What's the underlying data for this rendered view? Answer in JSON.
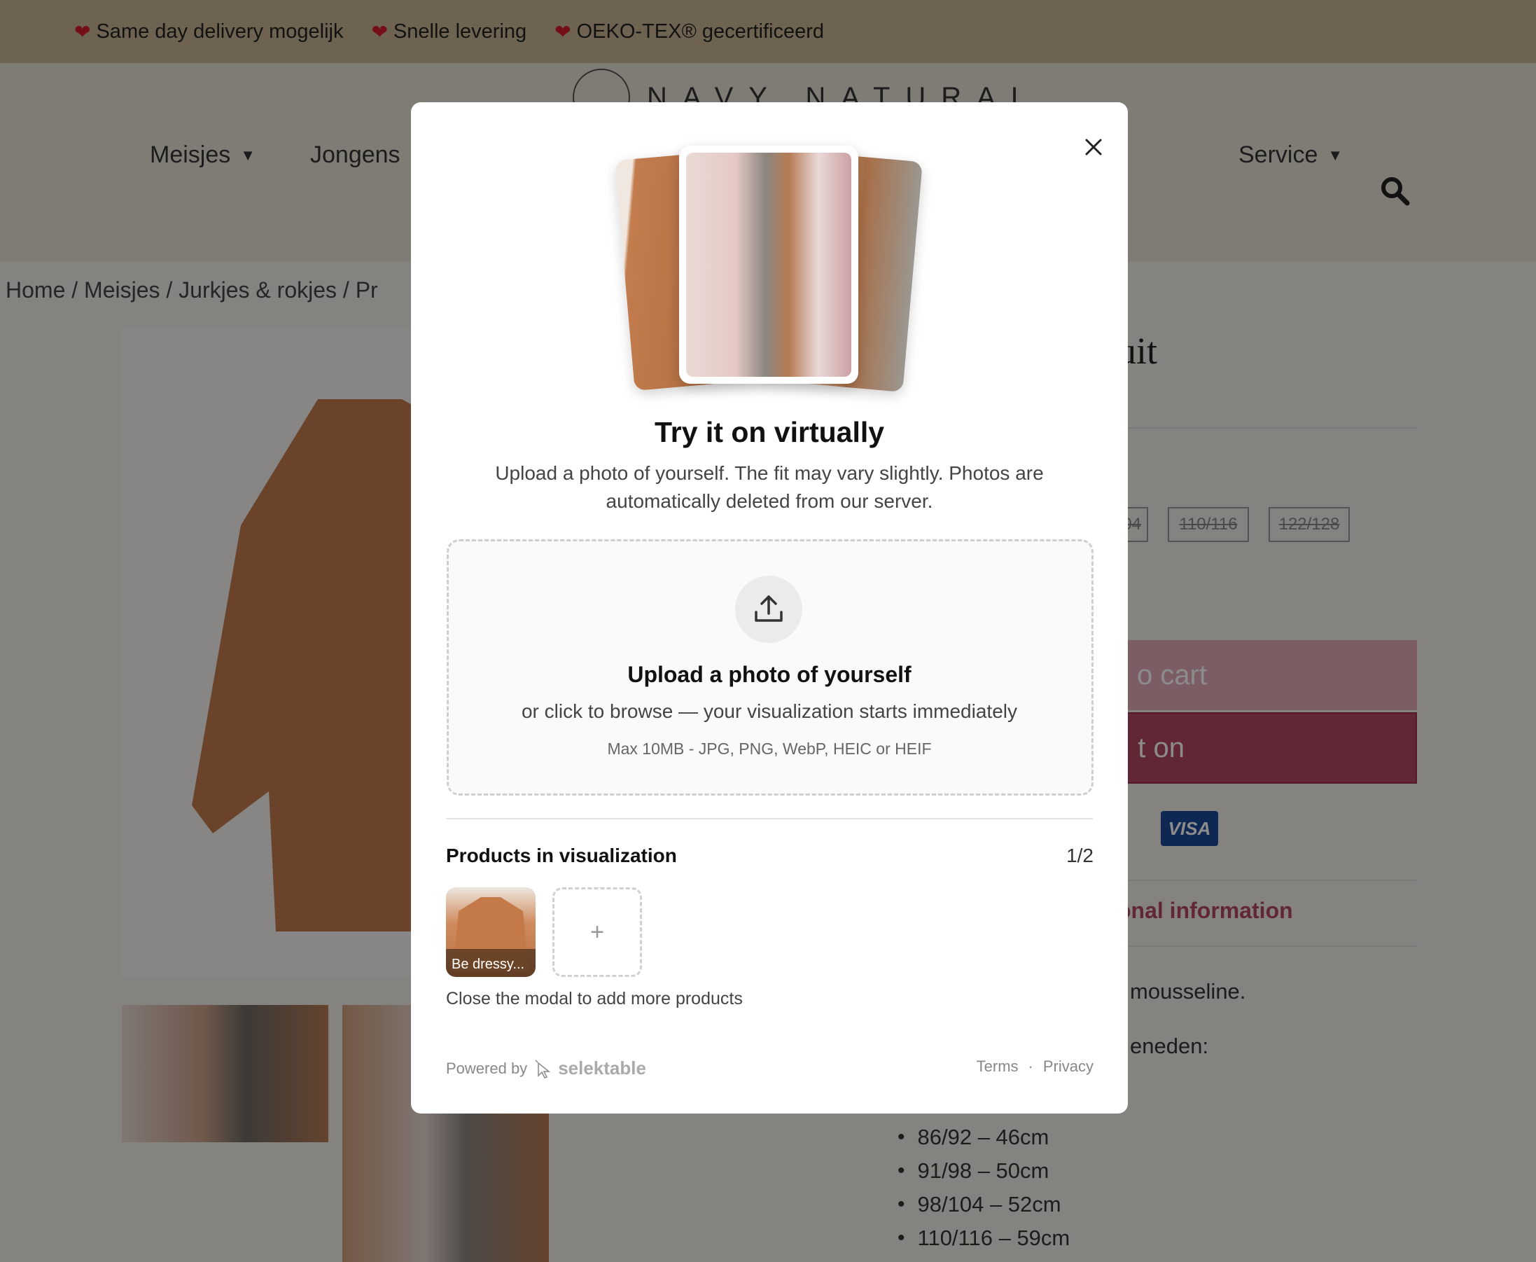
{
  "usp_bar": {
    "items": [
      {
        "text": "Same day delivery mogelijk"
      },
      {
        "text": "Snelle levering"
      },
      {
        "text": "OEKO-TEX® gecertificeerd"
      }
    ]
  },
  "header": {
    "logo_text": "NAVY NATURAL",
    "nav": {
      "meisjes": "Meisjes",
      "jongens": "Jongens",
      "service": "Service"
    }
  },
  "breadcrumb": "Home / Meisjes / Jurkjes & rokjes / Pr",
  "product": {
    "title_fragment": "uit",
    "sizes": [
      "8/104",
      "110/116",
      "122/128"
    ],
    "add_to_cart_fragment": "o cart",
    "try_on_fragment": "t on",
    "payment_badge": "VISA",
    "additional_info_fragment": "onal information",
    "desc_fragment_1": "mousseline.",
    "desc_fragment_2": "eneden:",
    "size_list": [
      "86/92 – 46cm",
      "91/98 – 50cm",
      "98/104 – 52cm",
      "110/116 – 59cm"
    ]
  },
  "modal": {
    "title": "Try it on virtually",
    "subtitle": "Upload a photo of yourself. The fit may vary slightly. Photos are automatically deleted from our server.",
    "dropzone": {
      "title": "Upload a photo of yourself",
      "subtitle": "or click to browse — your visualization starts immediately",
      "meta": "Max 10MB - JPG, PNG, WebP, HEIC or HEIF"
    },
    "products": {
      "heading": "Products in visualization",
      "count": "1/2",
      "items": [
        {
          "label": "Be dressy..."
        }
      ],
      "add_symbol": "+",
      "hint": "Close the modal to add more products"
    },
    "footer": {
      "powered_by": "Powered by",
      "brand": "selektable",
      "terms": "Terms",
      "separator": "·",
      "privacy": "Privacy"
    }
  },
  "colors": {
    "usp_bar": "#c9b592",
    "accent": "#b2475f",
    "heart": "#d31b2c"
  }
}
